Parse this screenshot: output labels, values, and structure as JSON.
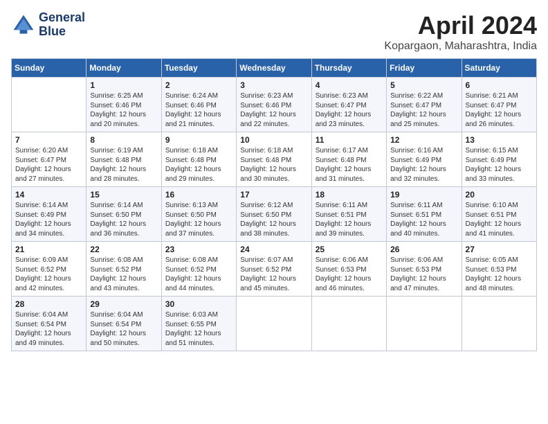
{
  "logo": {
    "line1": "General",
    "line2": "Blue"
  },
  "title": "April 2024",
  "location": "Kopargaon, Maharashtra, India",
  "days_header": [
    "Sunday",
    "Monday",
    "Tuesday",
    "Wednesday",
    "Thursday",
    "Friday",
    "Saturday"
  ],
  "weeks": [
    [
      {
        "num": "",
        "info": ""
      },
      {
        "num": "1",
        "info": "Sunrise: 6:25 AM\nSunset: 6:46 PM\nDaylight: 12 hours\nand 20 minutes."
      },
      {
        "num": "2",
        "info": "Sunrise: 6:24 AM\nSunset: 6:46 PM\nDaylight: 12 hours\nand 21 minutes."
      },
      {
        "num": "3",
        "info": "Sunrise: 6:23 AM\nSunset: 6:46 PM\nDaylight: 12 hours\nand 22 minutes."
      },
      {
        "num": "4",
        "info": "Sunrise: 6:23 AM\nSunset: 6:47 PM\nDaylight: 12 hours\nand 23 minutes."
      },
      {
        "num": "5",
        "info": "Sunrise: 6:22 AM\nSunset: 6:47 PM\nDaylight: 12 hours\nand 25 minutes."
      },
      {
        "num": "6",
        "info": "Sunrise: 6:21 AM\nSunset: 6:47 PM\nDaylight: 12 hours\nand 26 minutes."
      }
    ],
    [
      {
        "num": "7",
        "info": "Sunrise: 6:20 AM\nSunset: 6:47 PM\nDaylight: 12 hours\nand 27 minutes."
      },
      {
        "num": "8",
        "info": "Sunrise: 6:19 AM\nSunset: 6:48 PM\nDaylight: 12 hours\nand 28 minutes."
      },
      {
        "num": "9",
        "info": "Sunrise: 6:18 AM\nSunset: 6:48 PM\nDaylight: 12 hours\nand 29 minutes."
      },
      {
        "num": "10",
        "info": "Sunrise: 6:18 AM\nSunset: 6:48 PM\nDaylight: 12 hours\nand 30 minutes."
      },
      {
        "num": "11",
        "info": "Sunrise: 6:17 AM\nSunset: 6:48 PM\nDaylight: 12 hours\nand 31 minutes."
      },
      {
        "num": "12",
        "info": "Sunrise: 6:16 AM\nSunset: 6:49 PM\nDaylight: 12 hours\nand 32 minutes."
      },
      {
        "num": "13",
        "info": "Sunrise: 6:15 AM\nSunset: 6:49 PM\nDaylight: 12 hours\nand 33 minutes."
      }
    ],
    [
      {
        "num": "14",
        "info": "Sunrise: 6:14 AM\nSunset: 6:49 PM\nDaylight: 12 hours\nand 34 minutes."
      },
      {
        "num": "15",
        "info": "Sunrise: 6:14 AM\nSunset: 6:50 PM\nDaylight: 12 hours\nand 36 minutes."
      },
      {
        "num": "16",
        "info": "Sunrise: 6:13 AM\nSunset: 6:50 PM\nDaylight: 12 hours\nand 37 minutes."
      },
      {
        "num": "17",
        "info": "Sunrise: 6:12 AM\nSunset: 6:50 PM\nDaylight: 12 hours\nand 38 minutes."
      },
      {
        "num": "18",
        "info": "Sunrise: 6:11 AM\nSunset: 6:51 PM\nDaylight: 12 hours\nand 39 minutes."
      },
      {
        "num": "19",
        "info": "Sunrise: 6:11 AM\nSunset: 6:51 PM\nDaylight: 12 hours\nand 40 minutes."
      },
      {
        "num": "20",
        "info": "Sunrise: 6:10 AM\nSunset: 6:51 PM\nDaylight: 12 hours\nand 41 minutes."
      }
    ],
    [
      {
        "num": "21",
        "info": "Sunrise: 6:09 AM\nSunset: 6:52 PM\nDaylight: 12 hours\nand 42 minutes."
      },
      {
        "num": "22",
        "info": "Sunrise: 6:08 AM\nSunset: 6:52 PM\nDaylight: 12 hours\nand 43 minutes."
      },
      {
        "num": "23",
        "info": "Sunrise: 6:08 AM\nSunset: 6:52 PM\nDaylight: 12 hours\nand 44 minutes."
      },
      {
        "num": "24",
        "info": "Sunrise: 6:07 AM\nSunset: 6:52 PM\nDaylight: 12 hours\nand 45 minutes."
      },
      {
        "num": "25",
        "info": "Sunrise: 6:06 AM\nSunset: 6:53 PM\nDaylight: 12 hours\nand 46 minutes."
      },
      {
        "num": "26",
        "info": "Sunrise: 6:06 AM\nSunset: 6:53 PM\nDaylight: 12 hours\nand 47 minutes."
      },
      {
        "num": "27",
        "info": "Sunrise: 6:05 AM\nSunset: 6:53 PM\nDaylight: 12 hours\nand 48 minutes."
      }
    ],
    [
      {
        "num": "28",
        "info": "Sunrise: 6:04 AM\nSunset: 6:54 PM\nDaylight: 12 hours\nand 49 minutes."
      },
      {
        "num": "29",
        "info": "Sunrise: 6:04 AM\nSunset: 6:54 PM\nDaylight: 12 hours\nand 50 minutes."
      },
      {
        "num": "30",
        "info": "Sunrise: 6:03 AM\nSunset: 6:55 PM\nDaylight: 12 hours\nand 51 minutes."
      },
      {
        "num": "",
        "info": ""
      },
      {
        "num": "",
        "info": ""
      },
      {
        "num": "",
        "info": ""
      },
      {
        "num": "",
        "info": ""
      }
    ]
  ]
}
